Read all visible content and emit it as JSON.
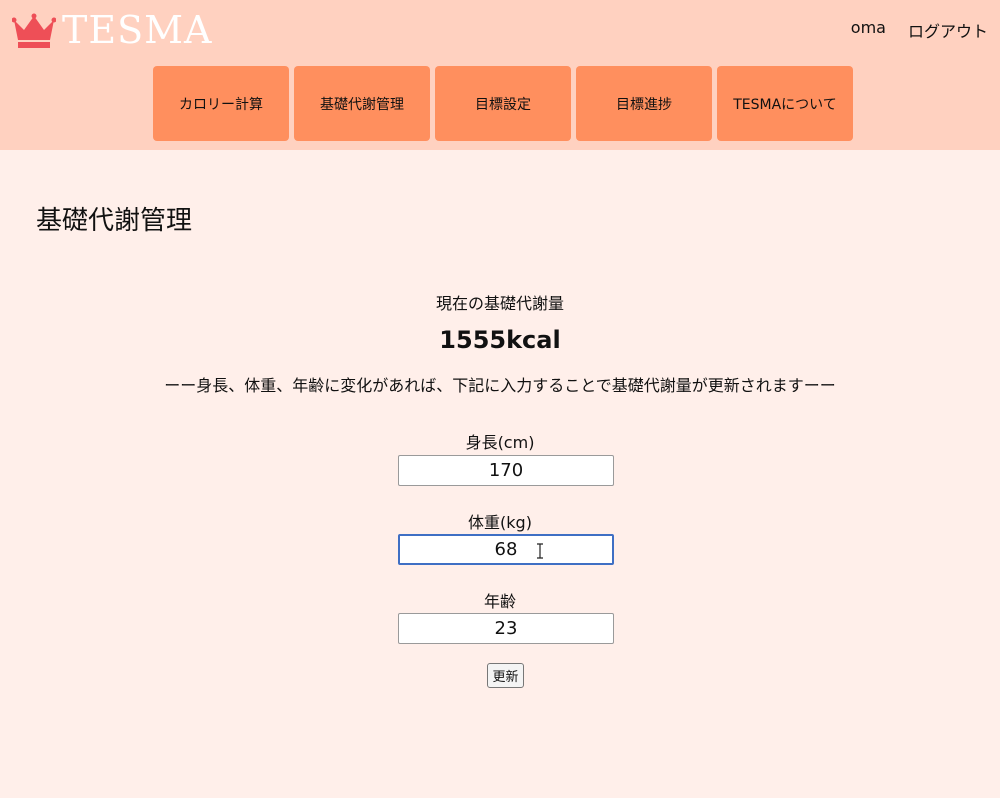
{
  "header": {
    "logo_text": "TESMA",
    "logo_icon": "crown-icon",
    "user_name": "oma",
    "logout_label": "ログアウト",
    "nav": [
      "カロリー計算",
      "基礎代謝管理",
      "目標設定",
      "目標進捗",
      "TESMAについて"
    ]
  },
  "page": {
    "title": "基礎代謝管理",
    "current_label": "現在の基礎代謝量",
    "bmr_value": "1555kcal",
    "notice": "ーー身長、体重、年齢に変化があれば、下記に入力することで基礎代謝量が更新されますーー"
  },
  "form": {
    "height_label": "身長(cm)",
    "height_value": "170",
    "weight_label": "体重(kg)",
    "weight_value": "68",
    "age_label": "年齢",
    "age_value": "23",
    "submit_label": "更新"
  },
  "colors": {
    "header_bg": "#ffd1c0",
    "nav_bg": "#ff8f5e",
    "page_bg": "#ffefea",
    "crown": "#ee4f57"
  }
}
